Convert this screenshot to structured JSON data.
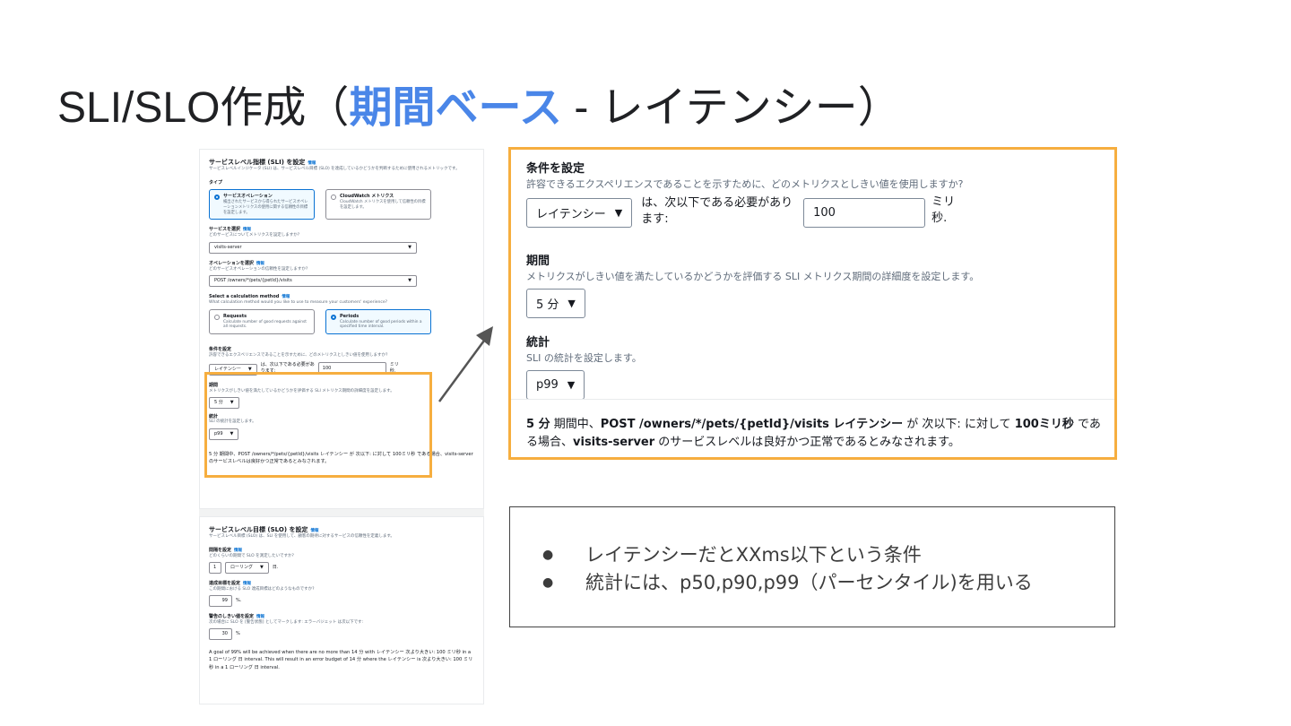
{
  "slide": {
    "title_prefix": "SLI/SLO作成（",
    "title_highlight": "期間ベース",
    "title_suffix": " - レイテンシー）"
  },
  "console": {
    "sli_heading": "サービスレベル指標 (SLI) を設定",
    "info": "情報",
    "sli_desc": "サービスレベルインジケータ (SLI) は、サービスレベル目標 (SLO) を達成しているかどうかを判断するために使用されるメトリックです。",
    "type_label": "タイプ",
    "type_option1_title": "サービスオペレーション",
    "type_option1_desc": "検出されたサービスから得られたサービスオペレーションメトリクスの使用に関する信頼性の目標を設定します。",
    "type_option2_title": "CloudWatch メトリクス",
    "type_option2_desc": "CloudWatch メトリクスを使用して信頼性の目標を設定します。",
    "service_label": "サービスを選択",
    "service_desc": "どのサービスについてメトリクスを設定しますか?",
    "service_value": "visits-server",
    "operation_label": "オペレーションを選択",
    "operation_desc": "どのサービスオペレーションの信頼性を設定しますか?",
    "operation_value": "POST /owners/*/pets/{petId}/visits",
    "calc_label": "Select a calculation method",
    "calc_desc": "What calculation method would you like to use to measure your customers' experience?",
    "calc_option1_title": "Requests",
    "calc_option1_desc": "Calculate number of good requests against all requests.",
    "calc_option2_title": "Periods",
    "calc_option2_desc": "Calculate number of good periods within a specified time interval.",
    "cond_heading": "条件を設定",
    "cond_desc": "許容できるエクスペリエンスであることを示すために、どのメトリクスとしきい値を使用しますか?",
    "metric_value": "レイテンシー",
    "cond_text": "は、次以下である必要があります:",
    "threshold": "100",
    "unit": "ミリ秒.",
    "period_heading": "期間",
    "period_desc": "メトリクスがしきい値を満たしているかどうかを評価する SLI メトリクス期間の詳細度を設定します。",
    "period_value": "5 分",
    "stat_heading": "統計",
    "stat_desc": "SLI の統計を設定します。",
    "stat_value": "p99",
    "summary": "5 分 期間中、POST /owners/*/pets/{petId}/visits レイテンシー が 次以下: に対して 100ミリ秒 である場合、visits-server のサービスレベルは良好かつ正常であるとみなされます。",
    "slo_heading": "サービスレベル目標 (SLO) を設定",
    "slo_desc": "サービスレベル目標 (SLO) は、SLI を使用して、顧客の期待に対するサービスの信頼性を定義します。",
    "interval_label": "間隔を設定",
    "interval_desc": "どのくらいの期間で SLO を測定したいですか?",
    "interval_value": "1",
    "interval_type": "ローリング",
    "interval_unit": "日.",
    "goal_label": "達成目標を設定",
    "goal_desc": "この期間における SLO 達成目標はどのようなものですか?",
    "goal_value": "99",
    "goal_unit": "%.",
    "warn_label": "警告のしきい値を設定",
    "warn_desc": "次の場合に SLO を [警告状態] としてマークします: エラーバジェット は次以下です:",
    "warn_value": "30",
    "warn_unit": "%",
    "goal_summary": "A goal of 99% will be achieved when there are no more than 14 分 with レイテンシー 次より大きい: 100 ミリ秒 in a 1 ローリング 日 interval. This will result in an error budget of 14 分 where the レイテンシー is 次より大きい: 100 ミリ秒 in a 1 ローリング 日 interval."
  },
  "zoom": {
    "cond_heading": "条件を設定",
    "cond_desc": "許容できるエクスペリエンスであることを示すために、どのメトリクスとしきい値を使用しますか?",
    "metric_value": "レイテンシー",
    "cond_text_1": "は、次以下である必要があり",
    "cond_text_2": "ます:",
    "threshold": "100",
    "unit_1": "ミリ",
    "unit_2": "秒.",
    "period_heading": "期間",
    "period_desc": "メトリクスがしきい値を満たしているかどうかを評価する SLI メトリクス期間の詳細度を設定します。",
    "period_value": "5 分",
    "stat_heading": "統計",
    "stat_desc": "SLI の統計を設定します。",
    "stat_value": "p99",
    "summary_parts": {
      "b1": "5 分",
      "t1": " 期間中、",
      "b2": "POST /owners/*/pets/{petId}/visits レイテンシー",
      "t2": " が 次以下: に対して ",
      "b3": "100ミリ秒",
      "t3": " である場合、",
      "b4": "visits-server",
      "t4": " のサービスレベルは良好かつ正常であるとみなされます。"
    }
  },
  "notes": [
    "レイテンシーだとXXms以下という条件",
    "統計には、p50,p90,p99（パーセンタイル)を用いる"
  ],
  "colors": {
    "highlight_blue": "#4a86e8",
    "orange_frame": "#f6ae3f",
    "aws_blue": "#0972d3"
  }
}
